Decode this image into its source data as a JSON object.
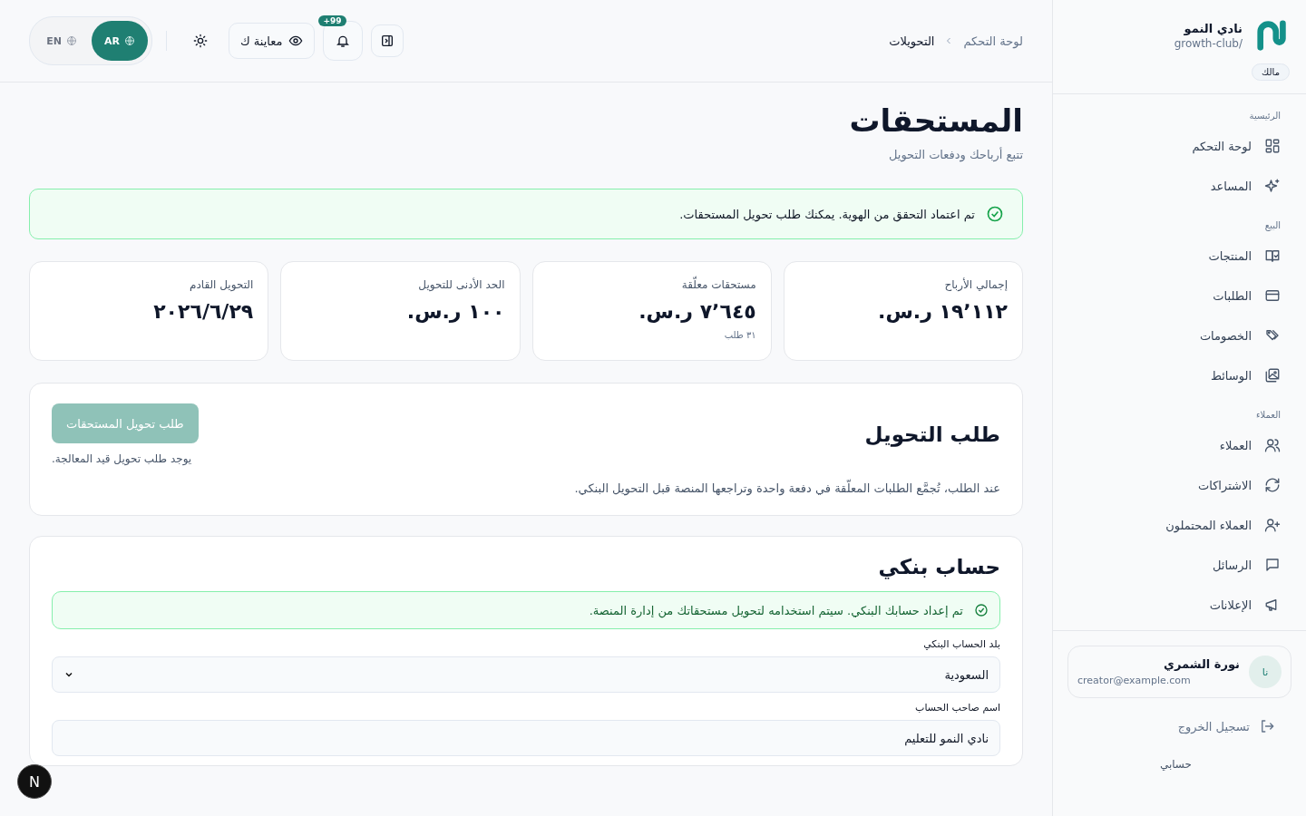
{
  "sidebar": {
    "brand": {
      "name": "نادي النمو",
      "slug": "growth-club/"
    },
    "role_badge": "مالك",
    "sections": [
      {
        "title": "الرئيسية",
        "items": [
          {
            "label": "لوحة التحكم"
          },
          {
            "label": "المساعد"
          }
        ]
      },
      {
        "title": "البيع",
        "items": [
          {
            "label": "المنتجات"
          },
          {
            "label": "الطلبات"
          },
          {
            "label": "الخصومات"
          },
          {
            "label": "الوسائط"
          }
        ]
      },
      {
        "title": "العملاء",
        "items": [
          {
            "label": "العملاء"
          },
          {
            "label": "الاشتراكات"
          },
          {
            "label": "العملاء المحتملون"
          },
          {
            "label": "الرسائل"
          },
          {
            "label": "الإعلانات"
          }
        ]
      }
    ],
    "user": {
      "initials": "نا",
      "name": "نورة الشمري",
      "email": "creator@example.com"
    },
    "logout": "تسجيل الخروج",
    "account": "حسابي"
  },
  "header": {
    "breadcrumb": [
      "لوحة التحكم",
      "التحويلات"
    ],
    "notifications_badge": "+99",
    "preview_button": "معاينة ك",
    "languages": [
      {
        "label": "AR",
        "selected": true
      },
      {
        "label": "EN",
        "selected": false
      }
    ]
  },
  "page": {
    "title": "المستحقات",
    "subtitle": "تتبع أرباحك ودفعات التحويل"
  },
  "verification_alert": "تم اعتماد التحقق من الهوية. يمكنك طلب تحويل المستحقات.",
  "stats": [
    {
      "label": "إجمالي الأرباح",
      "value": "١٩٬١١٢ ر.س."
    },
    {
      "label": "مستحقات معلّقة",
      "value": "٧٬٦٤٥ ر.س.",
      "note": "٣١ طلب"
    },
    {
      "label": "الحد الأدنى للتحويل",
      "value": "١٠٠ ر.س."
    },
    {
      "label": "التحويل القادم",
      "value": "٢٠٢٦/٦/٢٩"
    }
  ],
  "payout_request": {
    "title": "طلب التحويل",
    "button": {
      "label": "طلب تحويل المستحقات",
      "disabled": true
    },
    "button_note": "يوجد طلب تحويل قيد المعالجة.",
    "description": "عند الطلب، تُجمَّع الطلبات المعلّقة في دفعة واحدة وتراجعها المنصة قبل التحويل البنكي."
  },
  "bank_account": {
    "title": "حساب بنكي",
    "alert": "تم إعداد حسابك البنكي. سيتم استخدامه لتحويل مستحقاتك من إدارة المنصة.",
    "fields": [
      {
        "kind": "select",
        "label": "بلد الحساب البنكي",
        "value": "السعودية"
      },
      {
        "kind": "text",
        "label": "اسم صاحب الحساب",
        "value": "نادي النمو للتعليم"
      }
    ]
  },
  "dev_indicator": "N"
}
